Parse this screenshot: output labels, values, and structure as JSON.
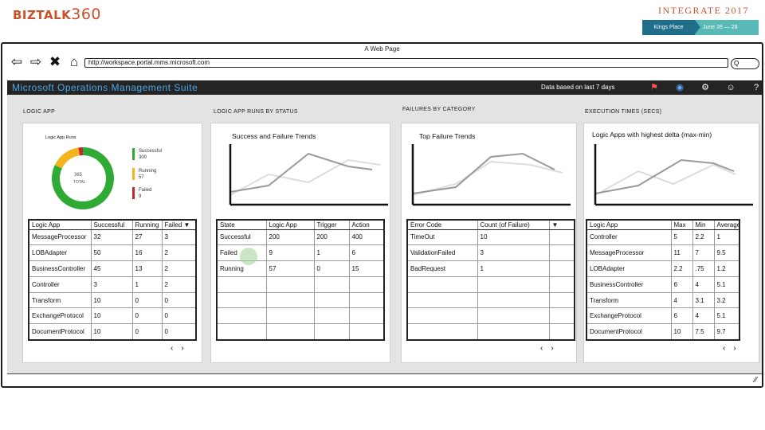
{
  "slide": {
    "logo_text": "BIZTALK",
    "logo_number": "360",
    "event_title": "INTEGRATE 2017",
    "event_place": "Kings Place",
    "event_date": "June 26 — 28"
  },
  "browser": {
    "window_title": "A Web Page",
    "url": "http://workspace.portal.mms.microsoft.com",
    "search_placeholder": "Q",
    "nav_icons": [
      "back-arrow-icon",
      "forward-arrow-icon",
      "close-icon",
      "home-icon"
    ]
  },
  "app": {
    "title": "Microsoft Operations Management Suite",
    "data_based": "Data based on last 7 days",
    "header_icons": [
      "alert-icon",
      "globe-icon",
      "settings-icon",
      "smiley-icon",
      "help-icon"
    ]
  },
  "columns": [
    {
      "title": "LOGIC APP",
      "tile": {
        "label": "Logic App Runs",
        "donut_total": "365",
        "donut_total_label": "TOTAL",
        "legend": [
          {
            "name": "Successful",
            "value": "300",
            "color": "#2eaa35"
          },
          {
            "name": "Running",
            "value": "57",
            "color": "#f2b51c"
          },
          {
            "name": "Failed",
            "value": "9",
            "color": "#c0282d"
          }
        ]
      },
      "table": {
        "headers": [
          "Logic App",
          "Successful",
          "Running",
          "Failed ▼"
        ],
        "rows": [
          [
            "MessageProcessor",
            "32",
            "27",
            "3"
          ],
          [
            "LOBAdapter",
            "50",
            "16",
            "2"
          ],
          [
            "BusinessController",
            "45",
            "13",
            "2"
          ],
          [
            "Controller",
            "3",
            "1",
            "2"
          ],
          [
            "Transform",
            "10",
            "0",
            "0"
          ],
          [
            "ExchangeProtocol",
            "10",
            "0",
            "0"
          ],
          [
            "DocumentProtocol",
            "10",
            "0",
            "0"
          ]
        ]
      }
    },
    {
      "title": "LOGIC APP RUNS BY STATUS",
      "tile": {
        "label": "Success and Failure Trends"
      },
      "table": {
        "headers": [
          "State",
          "Logic App",
          "Trigger",
          "Action"
        ],
        "rows": [
          [
            "Successful",
            "200",
            "200",
            "400"
          ],
          [
            "Failed",
            "9",
            "1",
            "6"
          ],
          [
            "Running",
            "57",
            "0",
            "15"
          ],
          [
            "",
            "",
            "",
            ""
          ],
          [
            "",
            "",
            "",
            ""
          ],
          [
            "",
            "",
            "",
            ""
          ],
          [
            "",
            "",
            "",
            ""
          ]
        ]
      }
    },
    {
      "title": "FAILURES BY CATEGORY",
      "tile": {
        "label": "Top Failure Trends"
      },
      "table": {
        "headers": [
          "Error Code",
          "Count (of Failure)",
          "▼"
        ],
        "rows": [
          [
            "TimeOut",
            "10",
            ""
          ],
          [
            "ValidationFailed",
            "3",
            ""
          ],
          [
            "BadRequest",
            "1",
            ""
          ],
          [
            "",
            "",
            ""
          ],
          [
            "",
            "",
            ""
          ],
          [
            "",
            "",
            ""
          ],
          [
            "",
            "",
            ""
          ]
        ]
      }
    },
    {
      "title": "EXECUTION TIMES (SECS)",
      "tile": {
        "label": "Logic Apps with highest delta (max-min)"
      },
      "table": {
        "headers": [
          "Logic App",
          "Max",
          "Min",
          "Average"
        ],
        "rows": [
          [
            "Controller",
            "5",
            "2.2",
            "1"
          ],
          [
            "MessageProcessor",
            "11",
            "7",
            "9.5"
          ],
          [
            "LOBAdapter",
            "2.2",
            ".75",
            "1.2"
          ],
          [
            "BusinessController",
            "6",
            "4",
            "5.1"
          ],
          [
            "Transform",
            "4",
            "3.1",
            "3.2"
          ],
          [
            "ExchangeProtocol",
            "6",
            "4",
            "5.1"
          ],
          [
            "DocumentProtocol",
            "10",
            "7.5",
            "9.7"
          ]
        ]
      }
    }
  ],
  "pager": {
    "prev": "‹",
    "next": "›"
  },
  "chart_data": {
    "type": "pie",
    "categories": [
      "Successful",
      "Running",
      "Failed"
    ],
    "values": [
      300,
      57,
      9
    ],
    "colors": [
      "#2eaa35",
      "#f2b51c",
      "#c0282d"
    ],
    "title": "Logic App Runs",
    "center_label": "365 TOTAL",
    "legend": "right"
  }
}
